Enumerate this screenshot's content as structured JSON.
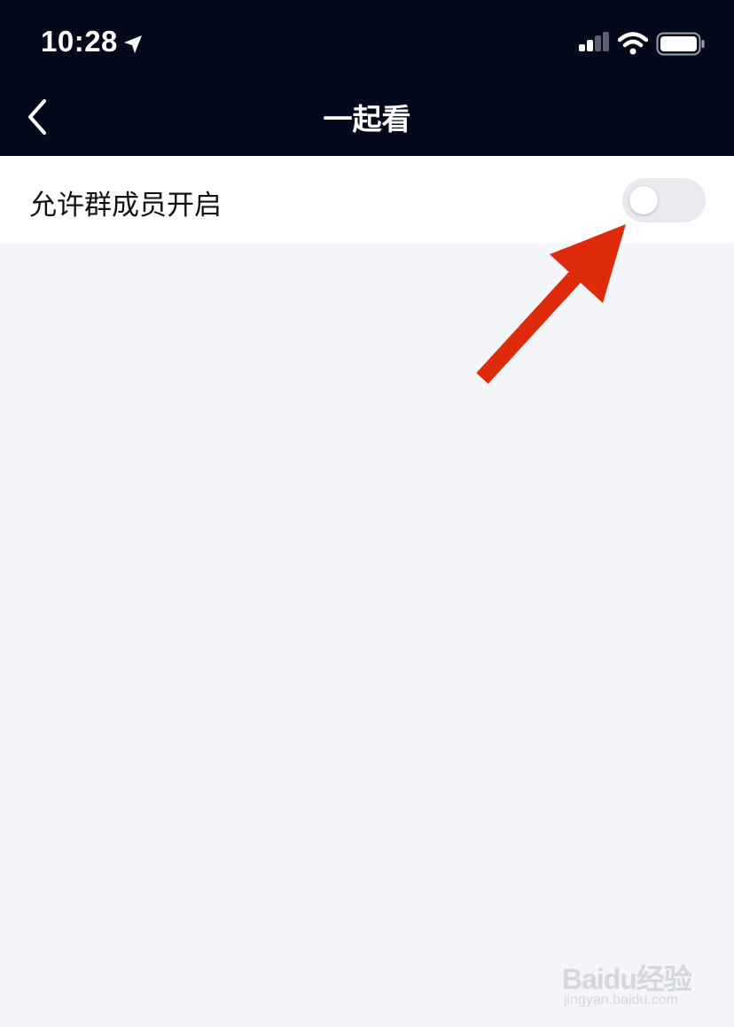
{
  "status_bar": {
    "time": "10:28",
    "icons": [
      "location-arrow-icon",
      "cellular-signal-icon",
      "wifi-icon",
      "battery-icon"
    ]
  },
  "nav": {
    "title": "一起看",
    "back_icon": "chevron-left-icon"
  },
  "settings": {
    "items": [
      {
        "label": "允许群成员开启",
        "toggle_on": false
      }
    ]
  },
  "annotation": {
    "arrow_color": "#e02a0c"
  },
  "watermark": {
    "logo": "Baidu经验",
    "url": "jingyan.baidu.com"
  },
  "colors": {
    "header_bg": "#030a1c",
    "page_bg": "#f4f5f9",
    "toggle_off": "#e9e9f0"
  }
}
